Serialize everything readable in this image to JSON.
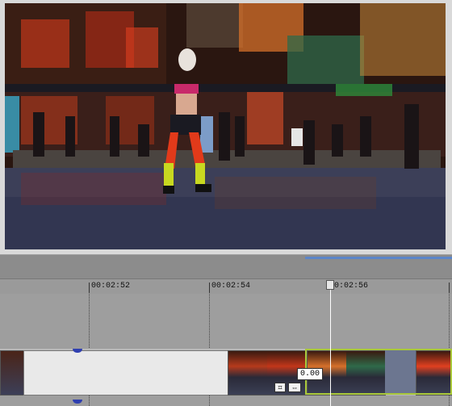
{
  "timeline": {
    "ruler_labels": [
      "00:02:52",
      "00:02:54",
      "00:02:56"
    ],
    "playhead_time_prefix": "",
    "playhead_label_suffix": "0:02:56",
    "event_value": "0.00"
  },
  "icons": {
    "crop": "crop-icon",
    "pan": "pan-icon",
    "playhead": "playhead-icon"
  },
  "colors": {
    "selection": "#a9c83a",
    "scroll_thumb": "#5b86c9",
    "marker": "#2f3fb0"
  }
}
